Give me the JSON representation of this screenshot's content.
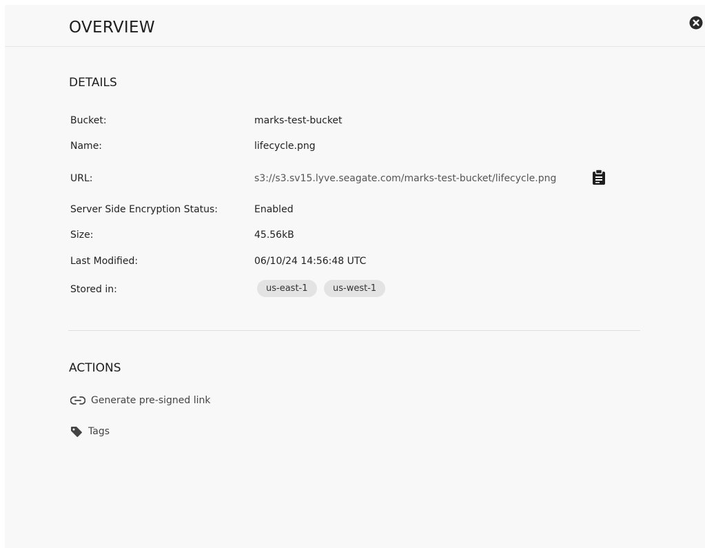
{
  "header": {
    "title": "OVERVIEW"
  },
  "details": {
    "title": "DETAILS",
    "rows": [
      {
        "label": "Bucket:",
        "value": "marks-test-bucket"
      },
      {
        "label": "Name:",
        "value": "lifecycle.png"
      },
      {
        "label": "URL:",
        "value": "s3://s3.sv15.lyve.seagate.com/marks-test-bucket/lifecycle.png"
      },
      {
        "label": "Server Side Encryption Status:",
        "value": "Enabled"
      },
      {
        "label": "Size:",
        "value": "45.56kB"
      },
      {
        "label": "Last Modified:",
        "value": "06/10/24 14:56:48 UTC"
      },
      {
        "label": "Stored in:",
        "chips": [
          "us-east-1",
          "us-west-1"
        ]
      }
    ]
  },
  "actions": {
    "title": "ACTIONS",
    "items": [
      {
        "label": "Generate pre-signed link",
        "icon": "link-icon"
      },
      {
        "label": "Tags",
        "icon": "tag-icon"
      }
    ]
  },
  "icons": {
    "close": "close-icon",
    "copy": "clipboard-icon"
  }
}
